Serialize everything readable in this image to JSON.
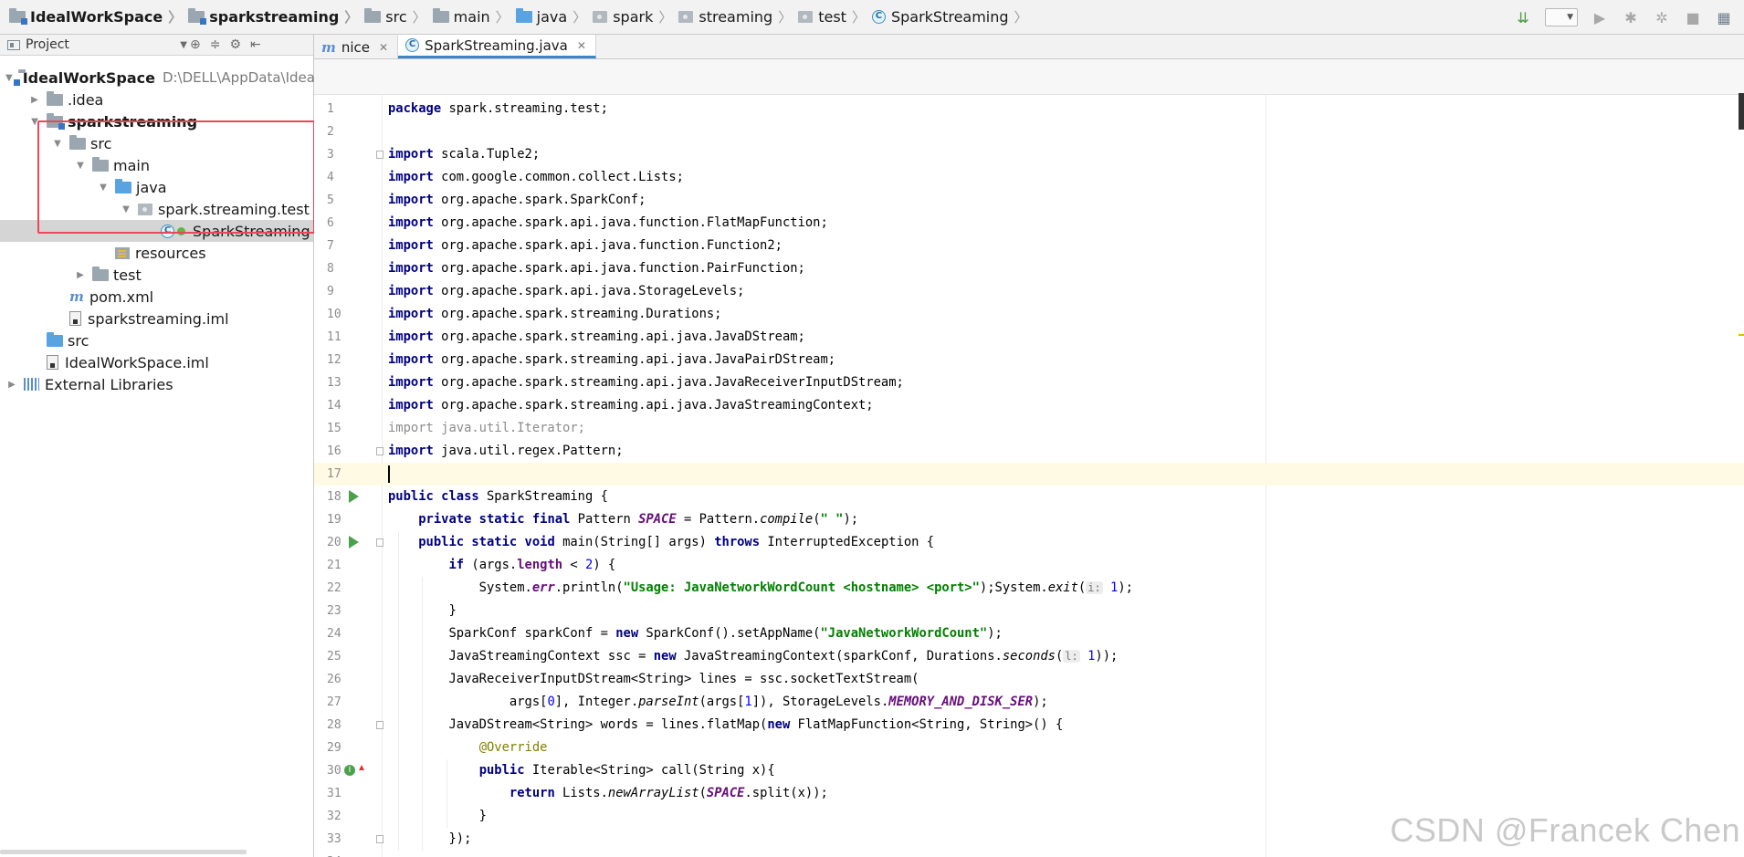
{
  "breadcrumbs": [
    "IdealWorkSpace",
    "sparkstreaming",
    "src",
    "main",
    "java",
    "spark",
    "streaming",
    "test",
    "SparkStreaming"
  ],
  "project_panel": {
    "title": "Project",
    "tree": [
      {
        "label": "IdealWorkSpace",
        "hint": "D:\\DELL\\AppData\\Idea",
        "bold": true,
        "depth": 0,
        "arrow": "down",
        "icon": "module-folder-icon"
      },
      {
        "label": ".idea",
        "depth": 1,
        "arrow": "right",
        "icon": "folder-icon"
      },
      {
        "label": "sparkstreaming",
        "bold": true,
        "depth": 1,
        "arrow": "down",
        "icon": "module-folder-icon"
      },
      {
        "label": "src",
        "depth": 2,
        "arrow": "down",
        "icon": "folder-icon"
      },
      {
        "label": "main",
        "depth": 3,
        "arrow": "down",
        "icon": "folder-icon"
      },
      {
        "label": "java",
        "depth": 4,
        "arrow": "down",
        "icon": "source-folder-icon"
      },
      {
        "label": "spark.streaming.test",
        "depth": 5,
        "arrow": "down",
        "icon": "package-icon"
      },
      {
        "label": "SparkStreaming",
        "depth": 6,
        "arrow": "none",
        "icon": "java-class-icon",
        "selected": true
      },
      {
        "label": "resources",
        "depth": 4,
        "arrow": "none",
        "icon": "resources-folder-icon"
      },
      {
        "label": "test",
        "depth": 3,
        "arrow": "right",
        "icon": "folder-icon"
      },
      {
        "label": "pom.xml",
        "depth": 2,
        "arrow": "none",
        "icon": "maven-icon"
      },
      {
        "label": "sparkstreaming.iml",
        "depth": 2,
        "arrow": "none",
        "icon": "iml-file-icon"
      },
      {
        "label": "src",
        "depth": 1,
        "arrow": "none",
        "icon": "source-folder-icon"
      },
      {
        "label": "IdealWorkSpace.iml",
        "depth": 1,
        "arrow": "none",
        "icon": "iml-file-icon"
      },
      {
        "label": "External Libraries",
        "depth": 0,
        "arrow": "right",
        "icon": "library-icon"
      }
    ]
  },
  "tabs": [
    {
      "label": "nice",
      "icon": "maven-icon",
      "active": false
    },
    {
      "label": "SparkStreaming.java",
      "icon": "java-class-icon",
      "active": true
    }
  ],
  "code_lines": [
    [
      [
        "kw",
        "package"
      ],
      [
        "",
        "spark.streaming.test;"
      ]
    ],
    [],
    [
      [
        "kw",
        "import"
      ],
      [
        "",
        "scala.Tuple2;"
      ]
    ],
    [
      [
        "kw",
        "import"
      ],
      [
        "",
        "com.google.common.collect.Lists;"
      ]
    ],
    [
      [
        "kw",
        "import"
      ],
      [
        "",
        "org.apache.spark.SparkConf;"
      ]
    ],
    [
      [
        "kw",
        "import"
      ],
      [
        "",
        "org.apache.spark.api.java.function.FlatMapFunction;"
      ]
    ],
    [
      [
        "kw",
        "import"
      ],
      [
        "",
        "org.apache.spark.api.java.function.Function2;"
      ]
    ],
    [
      [
        "kw",
        "import"
      ],
      [
        "",
        "org.apache.spark.api.java.function.PairFunction;"
      ]
    ],
    [
      [
        "kw",
        "import"
      ],
      [
        "",
        "org.apache.spark.api.java.StorageLevels;"
      ]
    ],
    [
      [
        "kw",
        "import"
      ],
      [
        "",
        "org.apache.spark.streaming.Durations;"
      ]
    ],
    [
      [
        "kw",
        "import"
      ],
      [
        "",
        "org.apache.spark.streaming.api.java.JavaDStream;"
      ]
    ],
    [
      [
        "kw",
        "import"
      ],
      [
        "",
        "org.apache.spark.streaming.api.java.JavaPairDStream;"
      ]
    ],
    [
      [
        "kw",
        "import"
      ],
      [
        "",
        "org.apache.spark.streaming.api.java.JavaReceiverInputDStream;"
      ]
    ],
    [
      [
        "kw",
        "import"
      ],
      [
        "",
        "org.apache.spark.streaming.api.java.JavaStreamingContext;"
      ]
    ],
    [
      [
        "unused",
        "import java.util.Iterator;"
      ]
    ],
    [
      [
        "kw",
        "import"
      ],
      [
        "",
        "java.util.regex.Pattern;"
      ]
    ],
    [],
    [
      [
        "kw",
        "public class"
      ],
      [
        "",
        " SparkStreaming {"
      ]
    ],
    [
      [
        "",
        "    "
      ],
      [
        "kw",
        "private static final"
      ],
      [
        "",
        " Pattern "
      ],
      [
        "static-field",
        "SPACE"
      ],
      [
        "",
        " = Pattern."
      ],
      [
        "static-method",
        "compile"
      ],
      [
        "",
        "("
      ],
      [
        "str",
        "\" \""
      ],
      [
        "",
        ");"
      ]
    ],
    [
      [
        "",
        "    "
      ],
      [
        "kw",
        "public static void"
      ],
      [
        "",
        " main(String[] args) "
      ],
      [
        "kw",
        "throws"
      ],
      [
        "",
        " InterruptedException {"
      ]
    ],
    [
      [
        "",
        "        "
      ],
      [
        "kw",
        "if"
      ],
      [
        "",
        " (args."
      ],
      [
        "field",
        "length"
      ],
      [
        "",
        " < "
      ],
      [
        "num",
        "2"
      ],
      [
        "",
        ") {"
      ]
    ],
    [
      [
        "",
        "            System."
      ],
      [
        "static-field",
        "err"
      ],
      [
        "",
        ".println("
      ],
      [
        "str",
        "\"Usage: JavaNetworkWordCount <hostname> <port>\""
      ],
      [
        "",
        ");System."
      ],
      [
        "static-method",
        "exit"
      ],
      [
        "",
        "("
      ],
      [
        "hint",
        "i:"
      ],
      [
        "num",
        " 1"
      ],
      [
        "",
        ");"
      ]
    ],
    [
      [
        "",
        "        }"
      ]
    ],
    [
      [
        "",
        "        SparkConf sparkConf = "
      ],
      [
        "kw",
        "new"
      ],
      [
        "",
        " SparkConf().setAppName("
      ],
      [
        "str",
        "\"JavaNetworkWordCount\""
      ],
      [
        "",
        ");"
      ]
    ],
    [
      [
        "",
        "        JavaStreamingContext ssc = "
      ],
      [
        "kw",
        "new"
      ],
      [
        "",
        " JavaStreamingContext(sparkConf, Durations."
      ],
      [
        "static-method",
        "seconds"
      ],
      [
        "",
        "("
      ],
      [
        "hint",
        "l:"
      ],
      [
        "num",
        " 1"
      ],
      [
        "",
        "));"
      ]
    ],
    [
      [
        "",
        "        JavaReceiverInputDStream<String> lines = ssc.socketTextStream("
      ]
    ],
    [
      [
        "",
        "                args["
      ],
      [
        "num",
        "0"
      ],
      [
        "",
        "], Integer."
      ],
      [
        "static-method",
        "parseInt"
      ],
      [
        "",
        "(args["
      ],
      [
        "num",
        "1"
      ],
      [
        "",
        "]), StorageLevels."
      ],
      [
        "static-field",
        "MEMORY_AND_DISK_SER"
      ],
      [
        "",
        ");"
      ]
    ],
    [
      [
        "",
        "        JavaDStream<String> words = lines.flatMap("
      ],
      [
        "kw",
        "new"
      ],
      [
        "",
        " FlatMapFunction<String, String>() {"
      ]
    ],
    [
      [
        "",
        "            "
      ],
      [
        "anno",
        "@Override"
      ]
    ],
    [
      [
        "",
        "            "
      ],
      [
        "kw",
        "public"
      ],
      [
        "",
        " Iterable<String> call(String x){"
      ]
    ],
    [
      [
        "",
        "                "
      ],
      [
        "kw",
        "return"
      ],
      [
        "",
        " Lists."
      ],
      [
        "static-method",
        "newArrayList"
      ],
      [
        "",
        "("
      ],
      [
        "static-field",
        "SPACE"
      ],
      [
        "",
        ".split(x));"
      ]
    ],
    [
      [
        "",
        "            }"
      ]
    ],
    [
      [
        "",
        "        });"
      ]
    ],
    []
  ],
  "watermark": "CSDN @Francek Chen"
}
